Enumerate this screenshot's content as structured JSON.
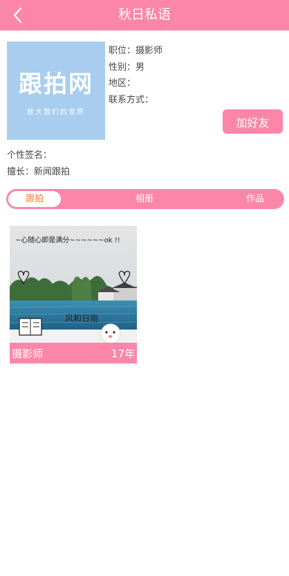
{
  "header": {
    "title": "秋日私语",
    "back_icon": "chevron-left-icon"
  },
  "profile": {
    "logo": {
      "text": "跟拍网",
      "slogan": "放大我们的世界"
    },
    "fields": [
      {
        "label": "职位：",
        "value": "摄影师"
      },
      {
        "label": "性别：",
        "value": "男"
      },
      {
        "label": "地区：",
        "value": ""
      },
      {
        "label": "联系方式：",
        "value": ""
      }
    ],
    "add_friend_label": "加好友",
    "signature": {
      "label": "个性签名：",
      "value": ""
    },
    "specialty": {
      "label": "擅长：",
      "value": "新闻跟拍"
    }
  },
  "tabs": [
    {
      "label": "跟拍",
      "active": true
    },
    {
      "label": "相册",
      "active": false
    },
    {
      "label": "作品",
      "active": false
    }
  ],
  "albums": [
    {
      "photo_text_top": "~心随心即是满分~~~~~~ok !!",
      "photo_text_bottom": "风和日丽",
      "title": "摄影师",
      "year": "17年"
    }
  ],
  "colors": {
    "primary": "#fc86a9",
    "active_tab_text": "#ff7a3a",
    "logo_bg": "#a8cdef"
  }
}
